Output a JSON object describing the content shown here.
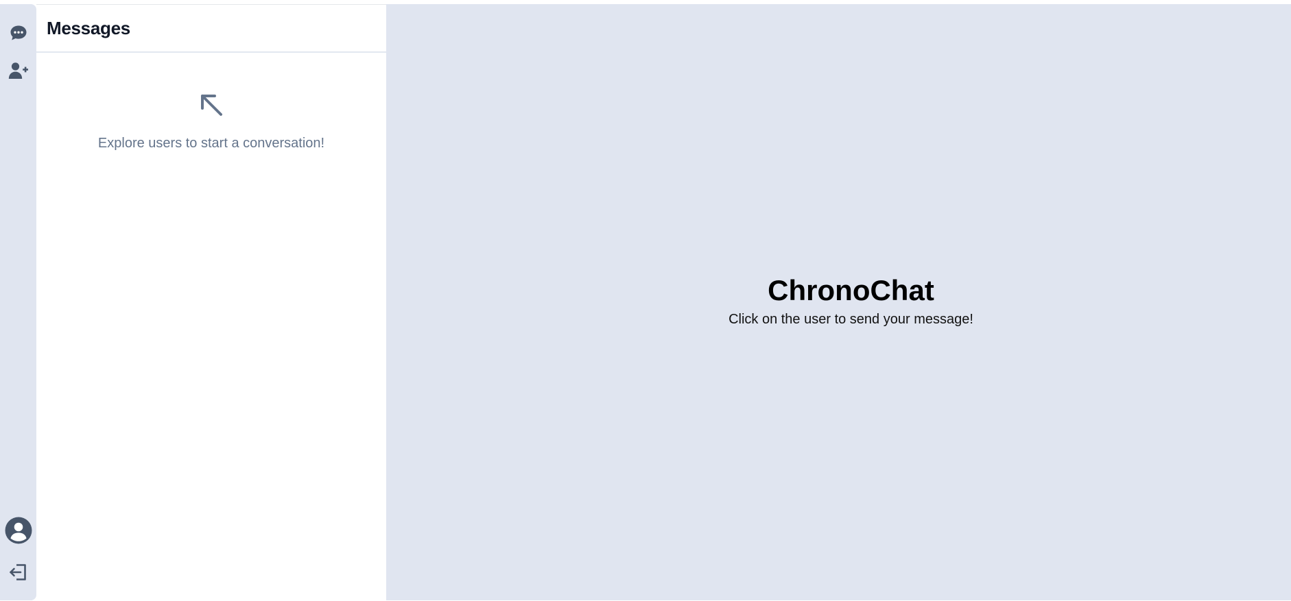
{
  "sidebar": {
    "icons": [
      {
        "name": "chat-icon",
        "label": "Chats"
      },
      {
        "name": "add-user-icon",
        "label": "Add user"
      },
      {
        "name": "profile-icon",
        "label": "Profile"
      },
      {
        "name": "logout-icon",
        "label": "Logout"
      }
    ]
  },
  "messages": {
    "title": "Messages",
    "empty_text": "Explore users to start a conversation!",
    "empty_icon": "arrow-up-left-icon"
  },
  "main": {
    "title": "ChronoChat",
    "subtitle": "Click on the user to send your message!"
  },
  "colors": {
    "rail_bg": "#e0e5f0",
    "main_bg": "#e0e5f0",
    "icon": "#475569",
    "muted_text": "#64748b"
  }
}
